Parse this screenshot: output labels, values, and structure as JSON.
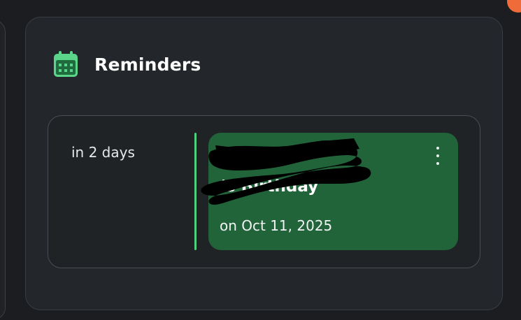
{
  "reminders_card": {
    "title": "Reminders",
    "icon": "calendar-icon",
    "accent_color": "#5ad58a",
    "items": [
      {
        "due": "in 2 days",
        "title": "'s Birthday",
        "date": "on Oct 11, 2025",
        "background_color": "#21643a",
        "more_icon": "more-vertical-icon",
        "name_redacted": true
      }
    ]
  }
}
